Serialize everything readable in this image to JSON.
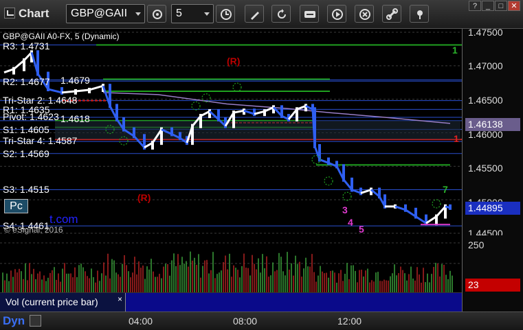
{
  "toolbar": {
    "app_title": "Chart",
    "symbol": "GBP@GAII",
    "interval": "5"
  },
  "window_controls": {
    "help": "?",
    "minimize": "_",
    "maximize": "□",
    "close": "✕"
  },
  "chart": {
    "legend": "GBP@GAII A0-FX, 5 (Dynamic)",
    "copyright": "© eSignal, 2016",
    "pc_label": "Pc",
    "partial_url": "t.com",
    "levels": [
      {
        "label": "R3: 1.4731",
        "price": 1.4731,
        "color": "#2a4fd0"
      },
      {
        "label": "R2: 1.4677",
        "price": 1.4677,
        "color": "#2a4fd0"
      },
      {
        "label": "1.4679",
        "price": 1.4679,
        "color": "#2a4fd0"
      },
      {
        "label": "R1: 1.4635",
        "price": 1.4635,
        "color": "#2a4fd0"
      },
      {
        "label": "Tri-Star 2: 1.4648",
        "price": 1.4648,
        "color": "#2a4fd0"
      },
      {
        "label": "Pivot: 1.4623",
        "price": 1.4623,
        "color": "#2a4fd0"
      },
      {
        "label": "1.4618",
        "price": 1.4618,
        "color": "#2a4fd0"
      },
      {
        "label": "S1: 1.4605",
        "price": 1.4605,
        "color": "#2a4fd0"
      },
      {
        "label": "Tri-Star 4: 1.4587",
        "price": 1.4587,
        "color": "#2a4fd0"
      },
      {
        "label": "S2: 1.4569",
        "price": 1.4569,
        "color": "#2a4fd0"
      },
      {
        "label": "S3: 1.4515",
        "price": 1.4515,
        "color": "#2a4fd0"
      },
      {
        "label": "S4: 1.4461",
        "price": 1.4461,
        "color": "#2a4fd0"
      }
    ],
    "r_markers": [
      "(R)",
      "(R)"
    ],
    "count_labels": [
      "3",
      "4",
      "5"
    ],
    "right_marks": [
      "1",
      "1",
      "7"
    ]
  },
  "price_axis": {
    "ticks": [
      "1.47500",
      "1.47000",
      "1.46500",
      "1.46000",
      "1.45500",
      "1.45000",
      "1.44500"
    ],
    "ma_tag": "1.46138",
    "last_price_tag": "1.44895"
  },
  "volume": {
    "tab_label": "Vol (current price bar)",
    "close_label": "×",
    "axis_top": "250",
    "last_value": "23"
  },
  "time_axis": {
    "ticks": [
      "04:00",
      "08:00",
      "12:00"
    ],
    "dyn_label": "Dyn"
  },
  "colors": {
    "up_bar": "#ffffff",
    "down_bar": "#2f5ff0",
    "support_line": "#2a4fd0",
    "green_line": "#1fa11f",
    "red_line": "#dd2222",
    "ma_line": "#9a7fc8",
    "vol_up": "#3aa03a",
    "vol_down": "#b22222",
    "tag_ma": "#6a5d8c",
    "tag_price": "#1a2fc0",
    "tag_vol": "#c40000"
  }
}
